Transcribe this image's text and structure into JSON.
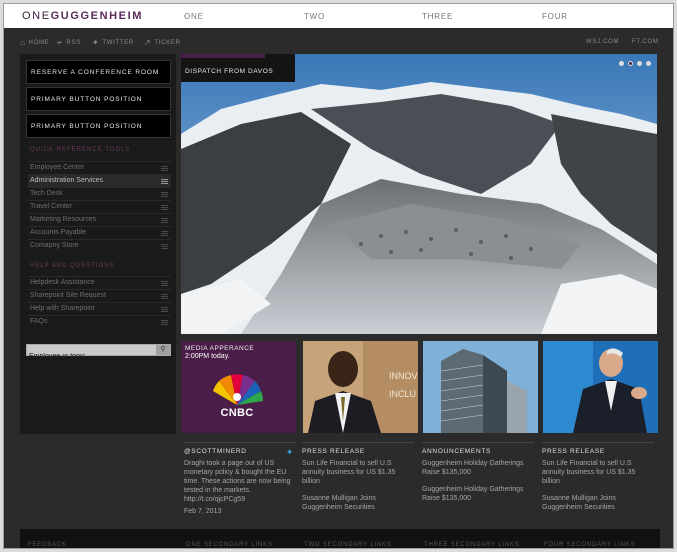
{
  "header": {
    "brand_light": "ONE",
    "brand_bold": "GUGGENHEIM",
    "nav": [
      "ONE",
      "TWO",
      "THREE",
      "FOUR"
    ]
  },
  "utility": {
    "left": [
      {
        "icon": "home-icon",
        "label": "HOME"
      },
      {
        "icon": "rss-icon",
        "label": "RSS"
      },
      {
        "icon": "twitter-icon",
        "label": "TWITTER"
      },
      {
        "icon": "ticker-icon",
        "label": "TICKER"
      }
    ],
    "right": [
      "WSJ.COM",
      "FT.COM"
    ]
  },
  "sidebar": {
    "buttons": [
      "RESERVE A CONFERENCE ROOM",
      "PRIMARY BUTTON POSITION",
      "PRIMARY BUTTON POSITION"
    ],
    "section1_title": "QUICK REFERENCE TOOLS",
    "section1_items": [
      "Employee Center",
      "Administration Services",
      "Tech Desk",
      "Travel Center",
      "Marketing Resources",
      "Accounts Payable",
      "Comapny Store"
    ],
    "section1_active": 1,
    "section2_title": "HELP AND QUESTIONS",
    "section2_items": [
      "Helpdesk Assistance",
      "Sharepoint Site Request",
      "Help with Sharepoint",
      "FAQs"
    ],
    "search_placeholder": "Employee or topic"
  },
  "hero": {
    "label": "DISPATCH FROM DAVOS",
    "slides": 4,
    "active_slide": 1
  },
  "tiles": {
    "tile1_title": "MEDIA APPERANCE",
    "tile1_sub": "2:00PM today.",
    "tile1_logo": "CNBC",
    "tile2_text": "INNOV",
    "tile2_text2": "INCLU"
  },
  "columns": [
    {
      "title": "@SCOTTMINERD",
      "icon": "twitter-icon",
      "body": [
        "Draghi took a page out of US monetary policy & bought the EU time. These actions are now being tested in the markets. http://t.co/qjcPCg59",
        "Feb 7, 2013"
      ]
    },
    {
      "title": "PRESS RELEASE",
      "body": [
        "Sun Life Financial to sell U.S annuity business for US $1.35 billion",
        "Susanne Mulligan Joins Guggenheim Securities"
      ]
    },
    {
      "title": "ANNOUNCEMENTS",
      "body": [
        "Guggenheim Holiday Gatherings Raise $135,000",
        "Guggenheim Holiday Gatherings Raise $135,000"
      ]
    },
    {
      "title": "PRESS RELEASE",
      "body": [
        "Sun Life Financial to sell U.S annuity business for US $1.35 billion",
        "Susanne Mulligan Joins Guggenheim Securities"
      ]
    }
  ],
  "footer": [
    "FEEDBACK",
    "ONE SECONDARY LINKS",
    "TWO SECONDARY LINKS",
    "THREE SECONDARY LINKS",
    "FOUR SECONDARY LINKS"
  ],
  "colors": {
    "brand_purple": "#4a1e48",
    "background": "#2b2b2b",
    "twitter_blue": "#3aa0e0"
  }
}
